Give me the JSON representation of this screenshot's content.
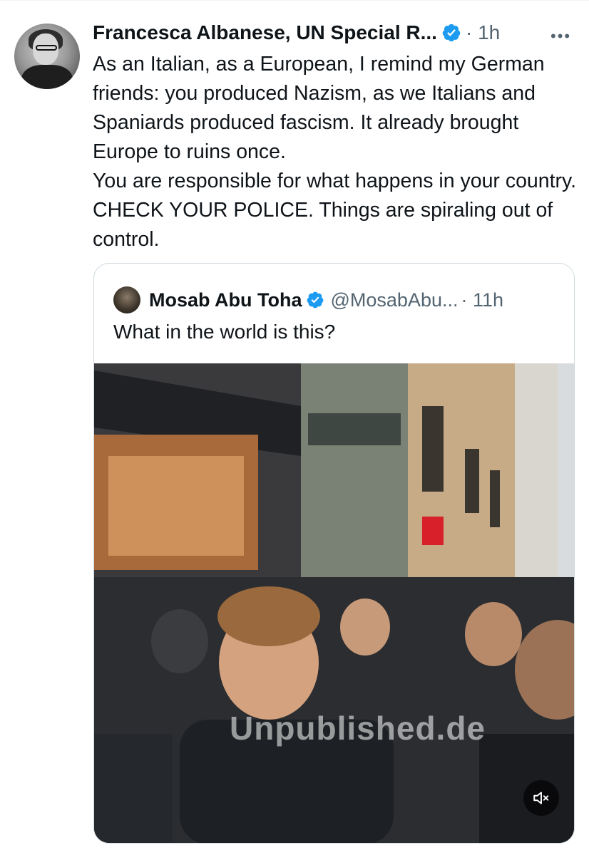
{
  "tweet": {
    "author_name": "Francesca Albanese, UN Special R...",
    "time": "1h",
    "more_label": "•••",
    "paragraphs": [
      "As an Italian, as a European, I remind my German friends: you produced Nazism, as we Italians and Spaniards produced fascism. It already brought Europe to ruins once.",
      "You are responsible for what happens in your country. CHECK YOUR POLICE. Things are spiraling out of control."
    ]
  },
  "quoted_tweet": {
    "author_name": "Mosab Abu Toha",
    "handle": "@MosabAbu...",
    "time": "11h",
    "text": "What in the world is this?",
    "video": {
      "watermark": "Unpublished.de",
      "muted": true
    }
  },
  "colors": {
    "verified": "#1d9bf0",
    "secondary_text": "#536471",
    "border": "#cfd9de"
  }
}
